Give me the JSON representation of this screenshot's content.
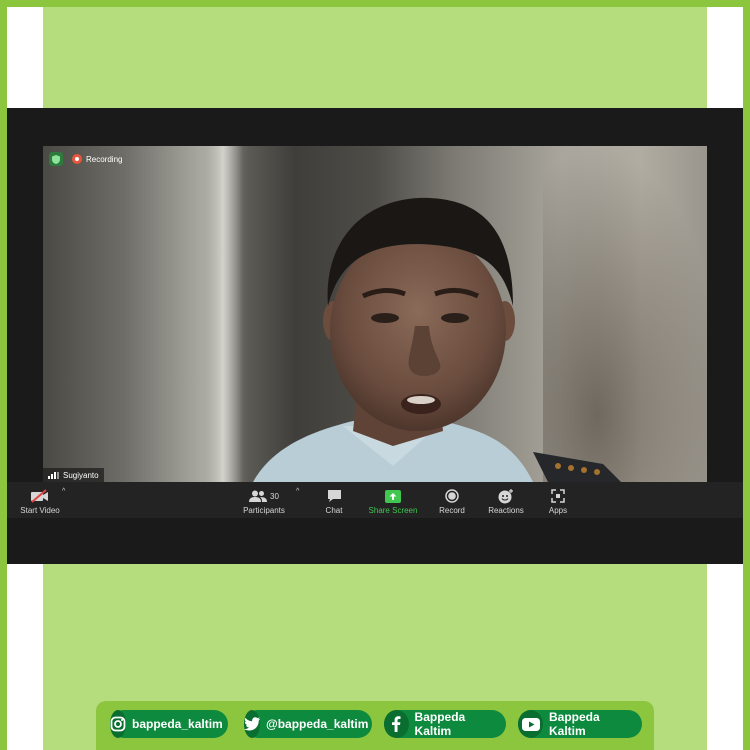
{
  "meeting": {
    "recording_label": "Recording",
    "participant_name": "Sugiyanto",
    "toolbar": {
      "start_video": "Start Video",
      "participants": "Participants",
      "participants_count": "30",
      "chat": "Chat",
      "share_screen": "Share Screen",
      "record": "Record",
      "reactions": "Reactions",
      "apps": "Apps"
    }
  },
  "social": {
    "instagram": "bappeda_kaltim",
    "twitter": "@bappeda_kaltim",
    "facebook": "Bappeda Kaltim",
    "youtube": "Bappeda Kaltim"
  },
  "colors": {
    "frame_green": "#8cc63f",
    "panel_green": "#b5dc7d",
    "pill_green": "#0e8a3e",
    "share_green": "#40c74f",
    "recording_red": "#e8563d"
  },
  "icons": [
    "security-shield-icon",
    "recording-icon",
    "signal-bars-icon",
    "video-off-icon",
    "participants-icon",
    "chat-icon",
    "share-screen-icon",
    "record-icon",
    "reactions-icon",
    "apps-icon",
    "instagram-icon",
    "twitter-icon",
    "facebook-icon",
    "youtube-icon"
  ]
}
